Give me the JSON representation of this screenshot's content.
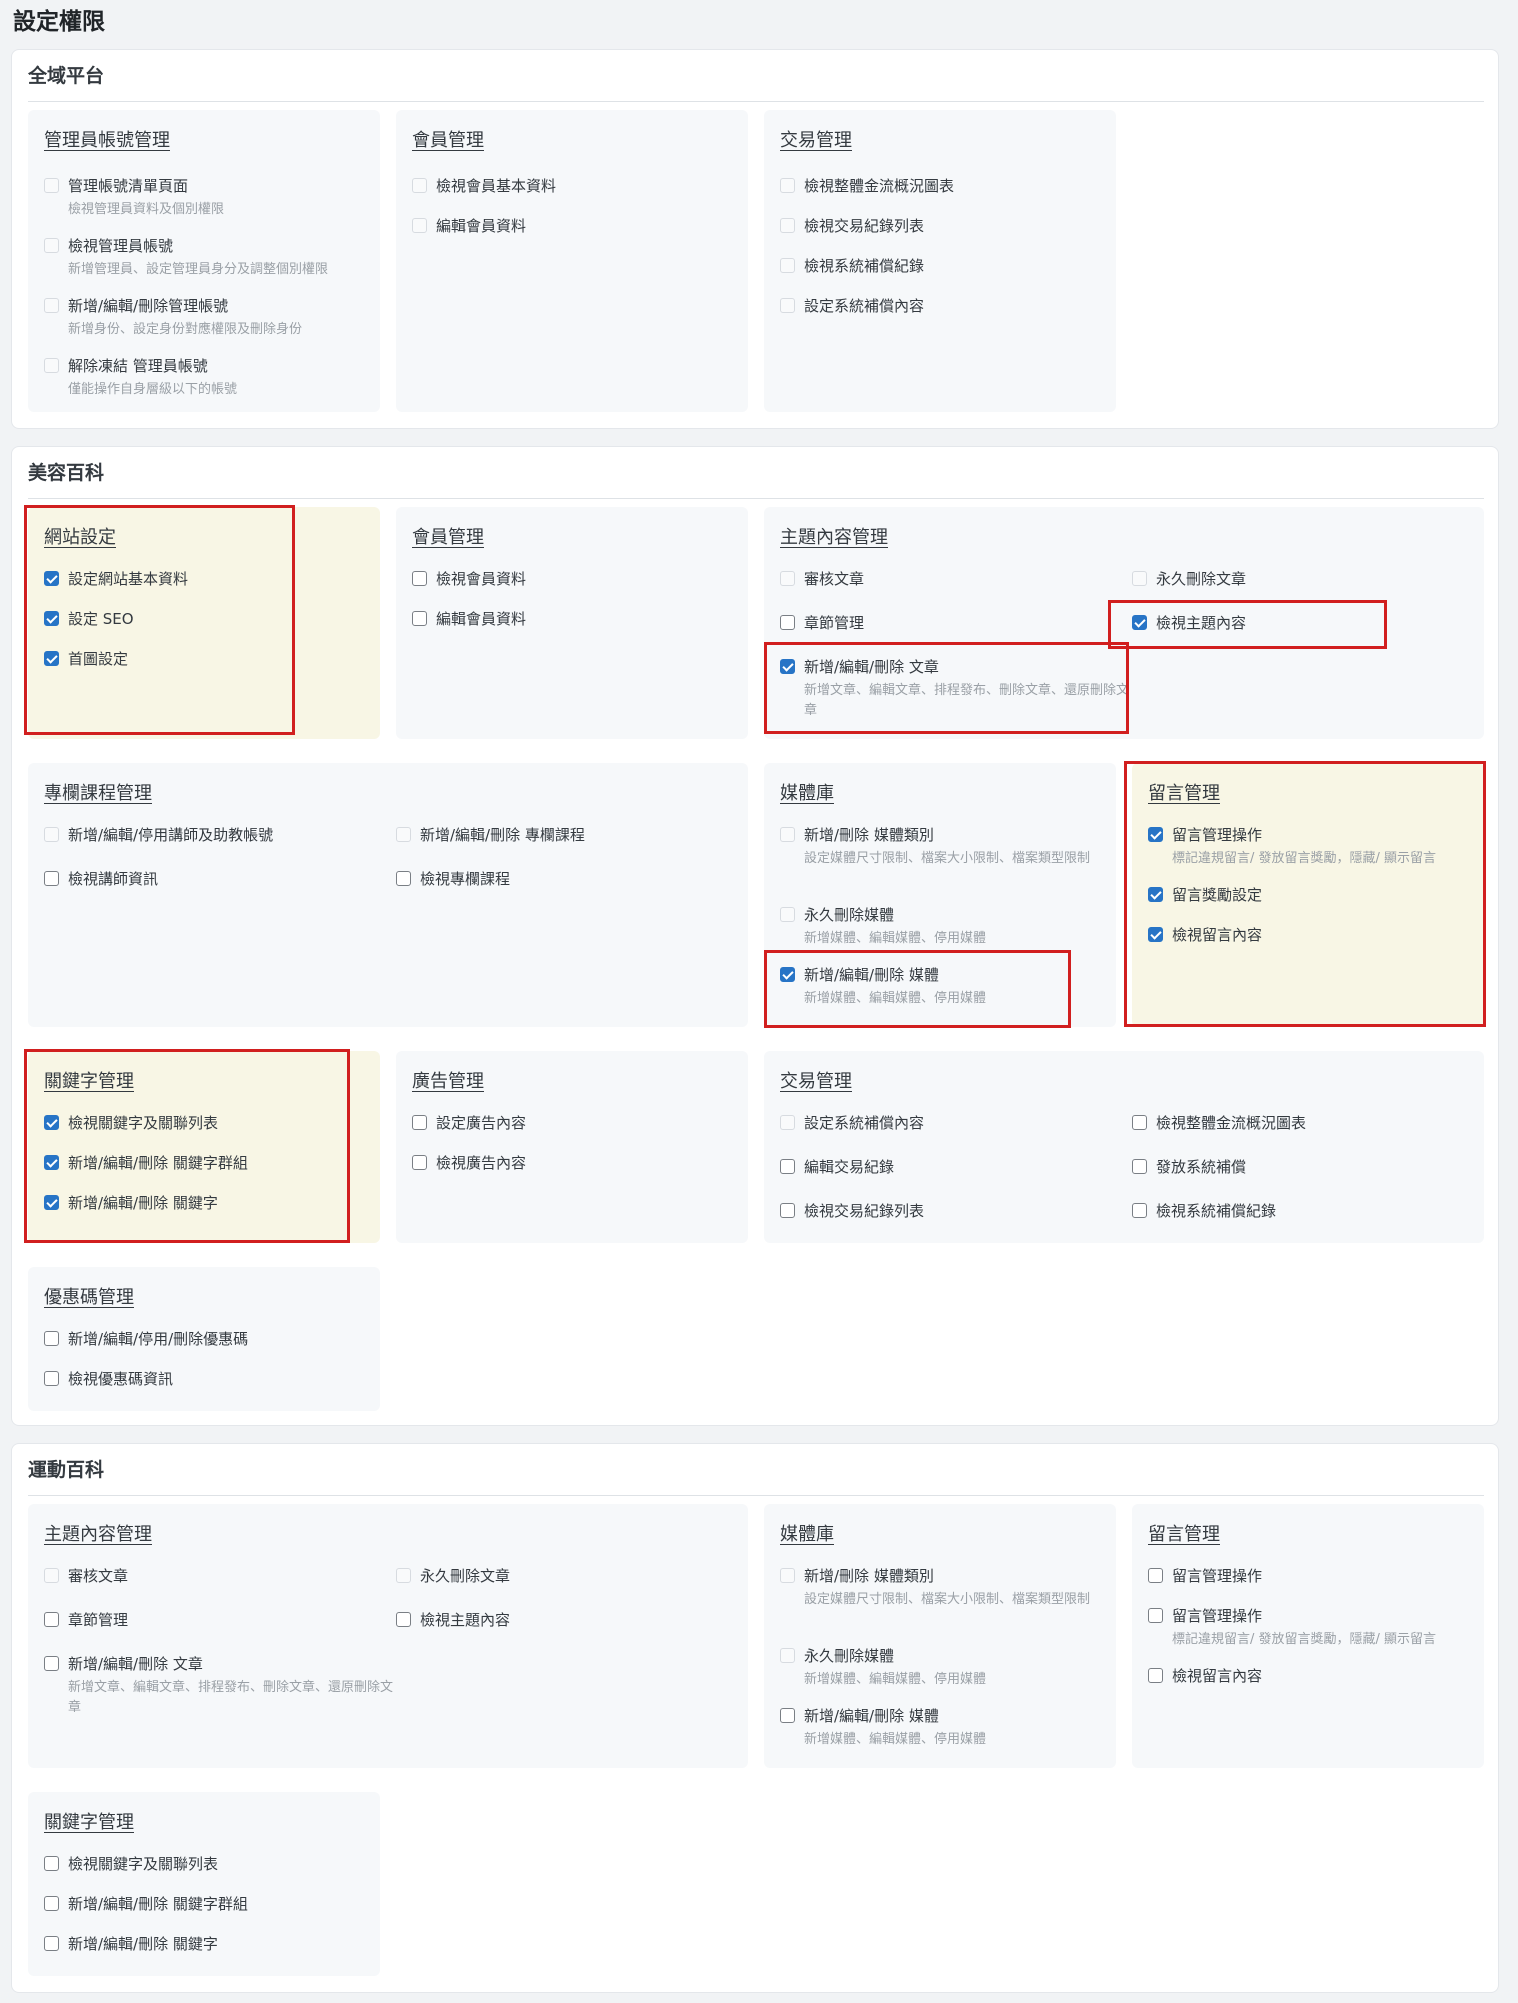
{
  "page_title": "設定權限",
  "sections": [
    {
      "title": "全域平台",
      "groups": [
        {
          "title": "管理員帳號管理",
          "items": [
            {
              "label": "管理帳號清單頁面",
              "desc": "檢視管理員資料及個別權限",
              "state": "disabled"
            },
            {
              "label": "檢視管理員帳號",
              "desc": "新增管理員、設定管理員身分及調整個別權限",
              "state": "disabled"
            },
            {
              "label": "新增/編輯/刪除管理帳號",
              "desc": "新增身份、設定身份對應權限及刪除身份",
              "state": "disabled"
            },
            {
              "label": "解除凍結 管理員帳號",
              "desc": "僅能操作自身層級以下的帳號",
              "state": "disabled"
            }
          ]
        },
        {
          "title": "會員管理",
          "items": [
            {
              "label": "檢視會員基本資料",
              "state": "disabled"
            },
            {
              "label": "編輯會員資料",
              "state": "disabled"
            }
          ]
        },
        {
          "title": "交易管理",
          "items": [
            {
              "label": "檢視整體金流概況圖表",
              "state": "disabled"
            },
            {
              "label": "檢視交易紀錄列表",
              "state": "disabled"
            },
            {
              "label": "檢視系統補償紀錄",
              "state": "disabled"
            },
            {
              "label": "設定系統補償內容",
              "state": "disabled"
            }
          ]
        }
      ]
    },
    {
      "title": "美容百科",
      "groups": [
        {
          "title": "網站設定",
          "items": [
            {
              "label": "設定網站基本資料",
              "state": "checked"
            },
            {
              "label": "設定 SEO",
              "state": "checked"
            },
            {
              "label": "首圖設定",
              "state": "checked"
            }
          ]
        },
        {
          "title": "會員管理",
          "items": [
            {
              "label": "檢視會員資料",
              "state": "unchecked"
            },
            {
              "label": "編輯會員資料",
              "state": "unchecked"
            }
          ]
        },
        {
          "title": "主題內容管理",
          "items": [
            {
              "label": "審核文章",
              "state": "disabled"
            },
            {
              "label": "永久刪除文章",
              "state": "disabled"
            },
            {
              "label": "章節管理",
              "state": "unchecked"
            },
            {
              "label": "檢視主題內容",
              "state": "checked"
            },
            {
              "label": "新增/編輯/刪除 文章",
              "desc": "新增文章、編輯文章、排程發布、刪除文章、還原刪除文章",
              "state": "checked"
            }
          ]
        },
        {
          "title": "專欄課程管理",
          "items": [
            {
              "label": "新增/編輯/停用講師及助教帳號",
              "state": "disabled"
            },
            {
              "label": "新增/編輯/刪除 專欄課程",
              "state": "disabled"
            },
            {
              "label": "檢視講師資訊",
              "state": "unchecked"
            },
            {
              "label": "檢視專欄課程",
              "state": "unchecked"
            }
          ]
        },
        {
          "title": "媒體庫",
          "items": [
            {
              "label": "新增/刪除 媒體類別",
              "desc": "設定媒體尺寸限制、檔案大小限制、檔案類型限制",
              "state": "disabled"
            },
            {
              "label": "永久刪除媒體",
              "desc": "新增媒體、編輯媒體、停用媒體",
              "state": "disabled"
            },
            {
              "label": "新增/編輯/刪除 媒體",
              "desc": "新增媒體、編輯媒體、停用媒體",
              "state": "checked"
            }
          ]
        },
        {
          "title": "留言管理",
          "items": [
            {
              "label": "留言管理操作",
              "desc": "標記違規留言/ 發放留言獎勵，隱藏/ 顯示留言",
              "state": "checked"
            },
            {
              "label": "留言獎勵設定",
              "state": "checked"
            },
            {
              "label": "檢視留言內容",
              "state": "checked"
            }
          ]
        },
        {
          "title": "關鍵字管理",
          "items": [
            {
              "label": "檢視關鍵字及關聯列表",
              "state": "checked"
            },
            {
              "label": "新增/編輯/刪除 關鍵字群組",
              "state": "checked"
            },
            {
              "label": "新增/編輯/刪除 關鍵字",
              "state": "checked"
            }
          ]
        },
        {
          "title": "廣告管理",
          "items": [
            {
              "label": "設定廣告內容",
              "state": "unchecked"
            },
            {
              "label": "檢視廣告內容",
              "state": "unchecked"
            }
          ]
        },
        {
          "title": "交易管理",
          "items": [
            {
              "label": "設定系統補償內容",
              "state": "disabled"
            },
            {
              "label": "檢視整體金流概況圖表",
              "state": "unchecked"
            },
            {
              "label": "編輯交易紀錄",
              "state": "unchecked"
            },
            {
              "label": "發放系統補償",
              "state": "unchecked"
            },
            {
              "label": "檢視交易紀錄列表",
              "state": "unchecked"
            },
            {
              "label": "檢視系統補償紀錄",
              "state": "unchecked"
            }
          ]
        },
        {
          "title": "優惠碼管理",
          "items": [
            {
              "label": "新增/編輯/停用/刪除優惠碼",
              "state": "unchecked"
            },
            {
              "label": "檢視優惠碼資訊",
              "state": "unchecked"
            }
          ]
        }
      ]
    },
    {
      "title": "運動百科",
      "groups": [
        {
          "title": "主題內容管理",
          "items": [
            {
              "label": "審核文章",
              "state": "disabled"
            },
            {
              "label": "永久刪除文章",
              "state": "disabled"
            },
            {
              "label": "章節管理",
              "state": "unchecked"
            },
            {
              "label": "檢視主題內容",
              "state": "unchecked"
            },
            {
              "label": "新增/編輯/刪除 文章",
              "desc": "新增文章、編輯文章、排程發布、刪除文章、還原刪除文章",
              "state": "unchecked"
            }
          ]
        },
        {
          "title": "媒體庫",
          "items": [
            {
              "label": "新增/刪除 媒體類別",
              "desc": "設定媒體尺寸限制、檔案大小限制、檔案類型限制",
              "state": "disabled"
            },
            {
              "label": "永久刪除媒體",
              "desc": "新增媒體、編輯媒體、停用媒體",
              "state": "disabled"
            },
            {
              "label": "新增/編輯/刪除 媒體",
              "desc": "新增媒體、編輯媒體、停用媒體",
              "state": "unchecked"
            }
          ]
        },
        {
          "title": "留言管理",
          "items": [
            {
              "label": "留言管理操作",
              "state": "unchecked"
            },
            {
              "label": "留言管理操作",
              "desc": "標記違規留言/ 發放留言獎勵，隱藏/ 顯示留言",
              "state": "unchecked"
            },
            {
              "label": "檢視留言內容",
              "state": "unchecked"
            }
          ]
        },
        {
          "title": "關鍵字管理",
          "items": [
            {
              "label": "檢視關鍵字及關聯列表",
              "state": "unchecked"
            },
            {
              "label": "新增/編輯/刪除 關鍵字群組",
              "state": "unchecked"
            },
            {
              "label": "新增/編輯/刪除 關鍵字",
              "state": "unchecked"
            }
          ]
        }
      ]
    }
  ],
  "colors": {
    "accent": "#2774c6",
    "highlight_border": "#d11f1f",
    "highlight_fill": "#f8f6e5"
  }
}
